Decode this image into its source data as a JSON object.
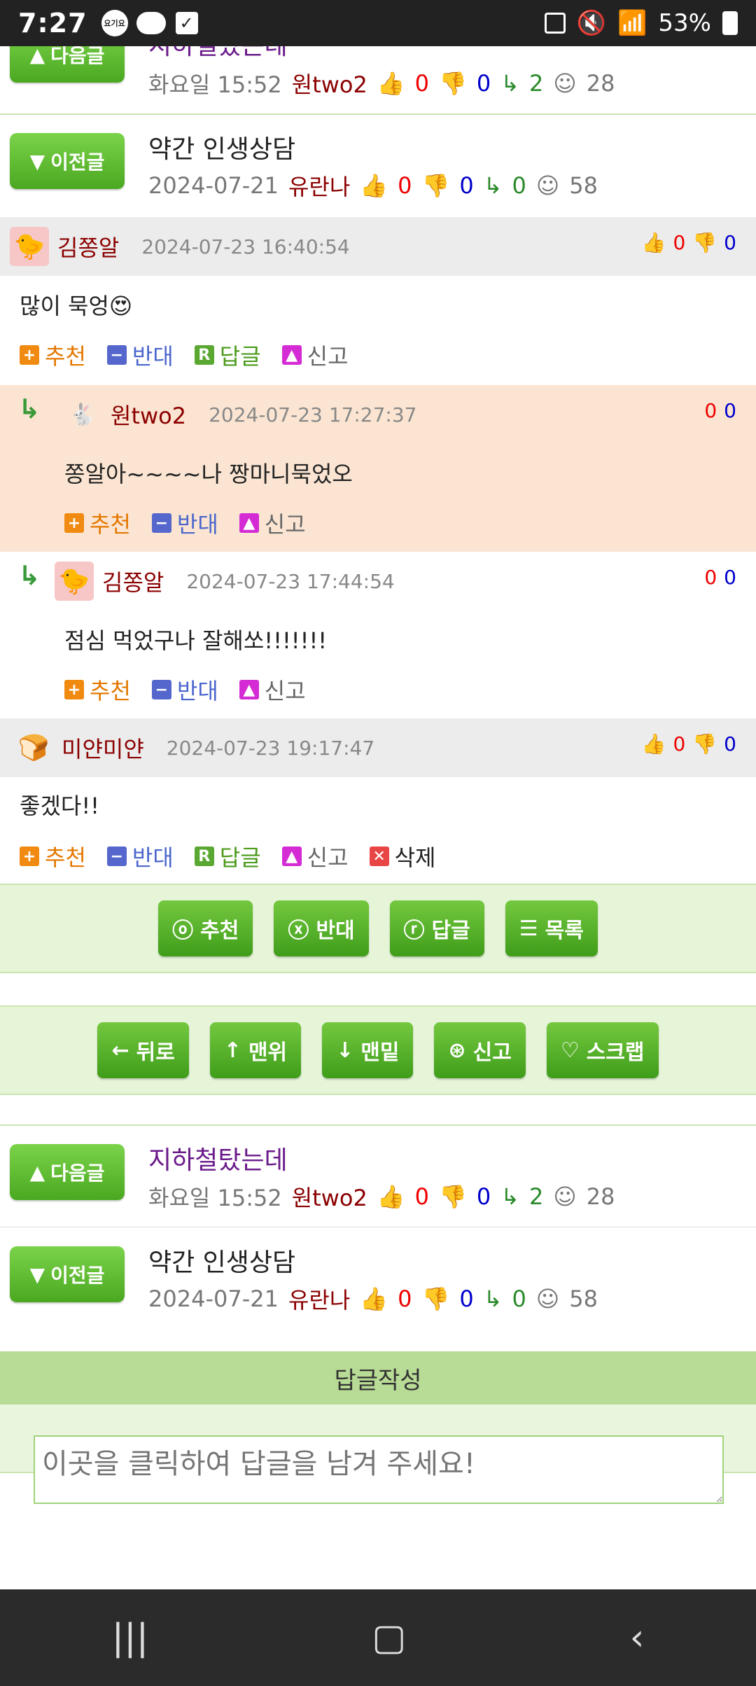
{
  "status": {
    "time": "7:27",
    "dot_label": "요기요",
    "battery": "53%"
  },
  "top_nav_partial": {
    "next": {
      "button": "다음글",
      "title": "지하철탔는데",
      "date": "화요일 15:52",
      "author": "원two2",
      "up": "0",
      "down": "0",
      "replies": "2",
      "views": "28"
    },
    "prev": {
      "button": "이전글",
      "title": "약간 인생상담",
      "date": "2024-07-21",
      "author": "유란나",
      "up": "0",
      "down": "0",
      "replies": "0",
      "views": "58"
    }
  },
  "comments": [
    {
      "name": "김쫑알",
      "date": "2024-07-23 16:40:54",
      "up": "0",
      "down": "0",
      "text": "많이 묵엉😍",
      "actions": [
        "추천",
        "반대",
        "답글",
        "신고"
      ]
    },
    {
      "name": "원two2",
      "date": "2024-07-23 17:27:37",
      "up": "0",
      "down": "0",
      "text": "쫑알아~~~~나 짱마니묵었오",
      "actions": [
        "추천",
        "반대",
        "신고"
      ]
    },
    {
      "name": "김쫑알",
      "date": "2024-07-23 17:44:54",
      "up": "0",
      "down": "0",
      "text": "점심 먹었구나 잘해쏘!!!!!!!",
      "actions": [
        "추천",
        "반대",
        "신고"
      ]
    },
    {
      "name": "미얀미얀",
      "date": "2024-07-23 19:17:47",
      "up": "0",
      "down": "0",
      "text": "좋겠다!!",
      "actions": [
        "추천",
        "반대",
        "답글",
        "신고",
        "삭제"
      ]
    }
  ],
  "action_buttons": [
    "추천",
    "반대",
    "답글",
    "목록"
  ],
  "nav_buttons": [
    "뒤로",
    "맨위",
    "맨밑",
    "신고",
    "스크랩"
  ],
  "bottom_nav": {
    "next": {
      "button": "다음글",
      "title": "지하철탔는데",
      "date": "화요일 15:52",
      "author": "원two2",
      "up": "0",
      "down": "0",
      "replies": "2",
      "views": "28"
    },
    "prev": {
      "button": "이전글",
      "title": "약간 인생상담",
      "date": "2024-07-21",
      "author": "유란나",
      "up": "0",
      "down": "0",
      "replies": "0",
      "views": "58"
    }
  },
  "reply": {
    "header": "답글작성",
    "placeholder": "이곳을 클릭하여 답글을 남겨 주세요!"
  },
  "colors": {
    "accent_green": "#4aa820",
    "band": "#e6f4d8",
    "reply_highlight": "#fbe5d2"
  }
}
